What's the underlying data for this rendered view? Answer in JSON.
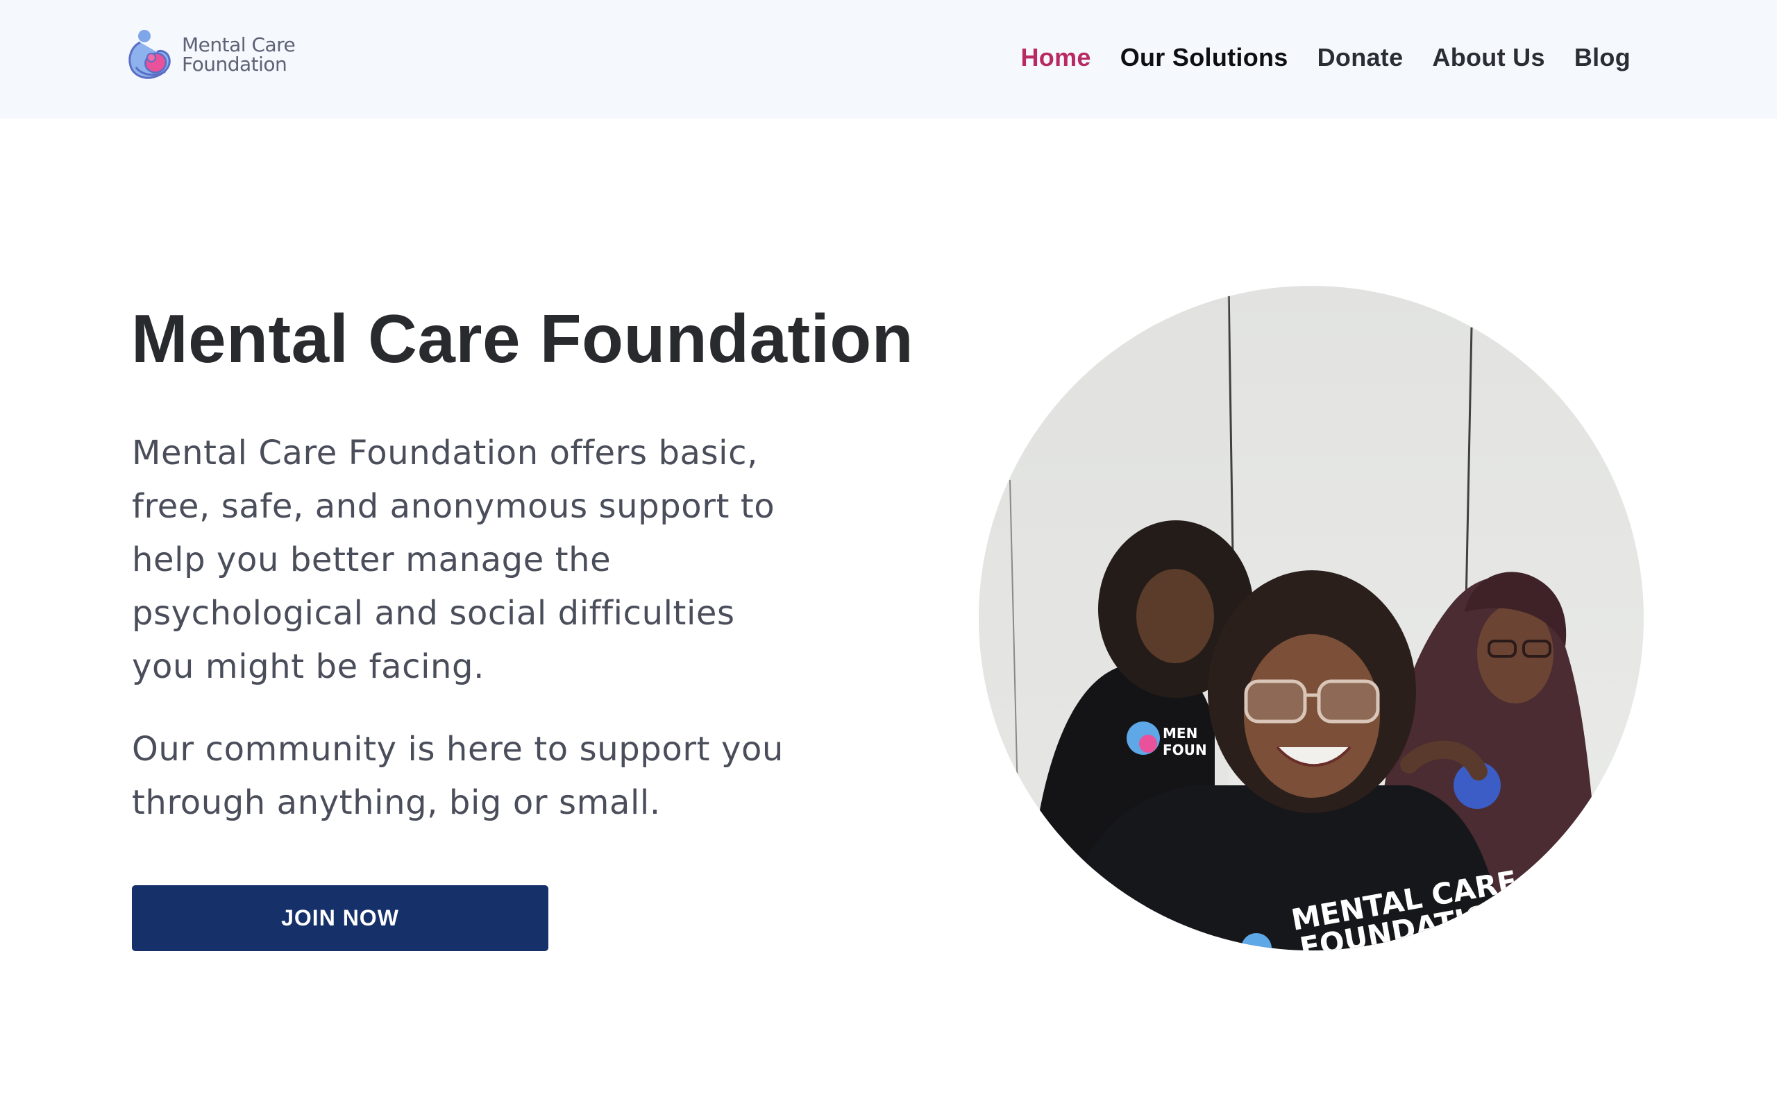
{
  "brand": {
    "line1": "Mental Care",
    "line2": "Foundation",
    "logo_icon": "mother-child-icon"
  },
  "nav": {
    "items": [
      {
        "label": "Home",
        "active": true
      },
      {
        "label": "Our Solutions"
      },
      {
        "label": "Donate"
      },
      {
        "label": "About Us"
      },
      {
        "label": "Blog"
      }
    ]
  },
  "hero": {
    "title": "Mental Care Foundation",
    "paragraph1": [
      "Mental Care Foundation offers basic,",
      "free, safe, and anonymous support to",
      "help you better manage the",
      "psychological and social difficulties",
      "you might be facing."
    ],
    "paragraph2": [
      "Our community is here to support you",
      "through anything, big or small."
    ],
    "cta_label": "JOIN NOW",
    "photo_shirt_text": [
      "MENTAL CARE",
      "FOUNDATION"
    ]
  },
  "colors": {
    "header_bg": "#f5f8fd",
    "accent": "#b82a61",
    "button_bg": "#16306a",
    "text": "#4a4d5a"
  }
}
